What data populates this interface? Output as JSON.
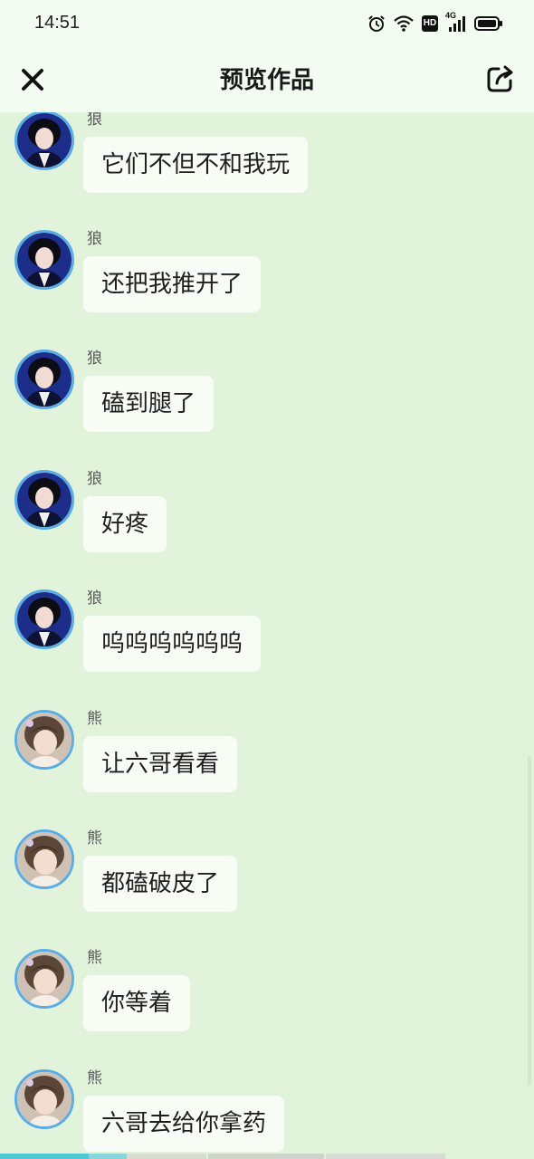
{
  "status_bar": {
    "time": "14:51",
    "icons": [
      "alarm-icon",
      "wifi-icon",
      "hd-icon",
      "cellular-4g-icon",
      "battery-icon"
    ],
    "hd_label": "HD",
    "network_label": "4G"
  },
  "header": {
    "title": "预览作品",
    "close_icon": "close-icon",
    "share_icon": "share-icon"
  },
  "messages": [
    {
      "sender": "狼",
      "text": "它们不但不和我玩",
      "avatar": "wolf-avatar"
    },
    {
      "sender": "狼",
      "text": "还把我推开了",
      "avatar": "wolf-avatar"
    },
    {
      "sender": "狼",
      "text": "磕到腿了",
      "avatar": "wolf-avatar"
    },
    {
      "sender": "狼",
      "text": "好疼",
      "avatar": "wolf-avatar"
    },
    {
      "sender": "狼",
      "text": "呜呜呜呜呜呜",
      "avatar": "wolf-avatar"
    },
    {
      "sender": "熊",
      "text": "让六哥看看",
      "avatar": "bear-avatar"
    },
    {
      "sender": "熊",
      "text": "都磕破皮了",
      "avatar": "bear-avatar"
    },
    {
      "sender": "熊",
      "text": "你等着",
      "avatar": "bear-avatar"
    },
    {
      "sender": "熊",
      "text": "六哥去给你拿药",
      "avatar": "bear-avatar"
    }
  ],
  "colors": {
    "background": "#e2f3dc",
    "header_background": "#f3fcf0",
    "bubble": "#f7fdf5",
    "avatar_ring": "#5aaee5",
    "progress_active": "#4dc9d6"
  }
}
